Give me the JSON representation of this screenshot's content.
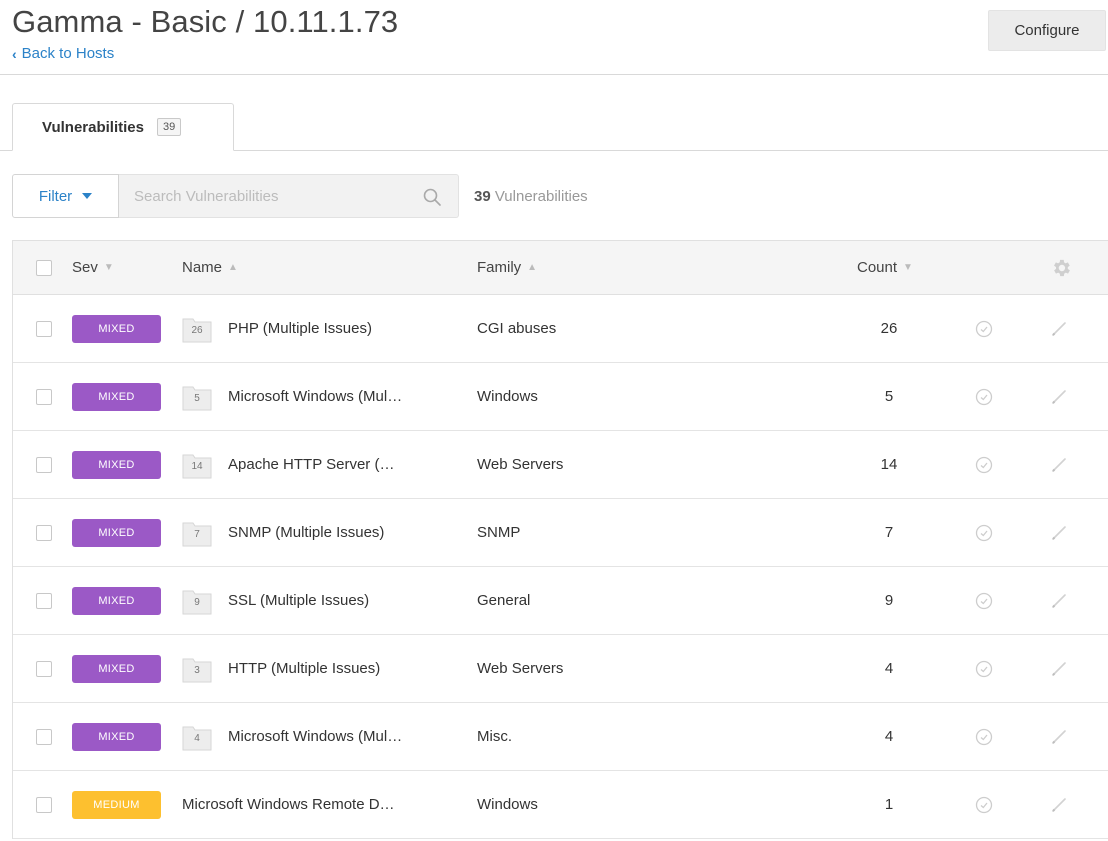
{
  "header": {
    "title": "Gamma - Basic / 10.11.1.73",
    "back_label": "Back to Hosts",
    "configure_label": "Configure"
  },
  "tabs": [
    {
      "label": "Vulnerabilities",
      "count": "39"
    }
  ],
  "toolbar": {
    "filter_label": "Filter",
    "search_placeholder": "Search Vulnerabilities",
    "result_count": "39",
    "result_label": "Vulnerabilities"
  },
  "table": {
    "columns": {
      "sev": "Sev",
      "name": "Name",
      "family": "Family",
      "count": "Count"
    },
    "sort_indicators": {
      "sev": "▼",
      "name": "▲",
      "family": "▲",
      "count": "▼"
    },
    "rows": [
      {
        "severity": "MIXED",
        "group_count": "26",
        "name": "PHP (Multiple Issues)",
        "family": "CGI abuses",
        "count": "26"
      },
      {
        "severity": "MIXED",
        "group_count": "5",
        "name": "Microsoft Windows (Mul…",
        "family": "Windows",
        "count": "5"
      },
      {
        "severity": "MIXED",
        "group_count": "14",
        "name": "Apache HTTP Server (…",
        "family": "Web Servers",
        "count": "14"
      },
      {
        "severity": "MIXED",
        "group_count": "7",
        "name": "SNMP (Multiple Issues)",
        "family": "SNMP",
        "count": "7"
      },
      {
        "severity": "MIXED",
        "group_count": "9",
        "name": "SSL (Multiple Issues)",
        "family": "General",
        "count": "9"
      },
      {
        "severity": "MIXED",
        "group_count": "3",
        "name": "HTTP (Multiple Issues)",
        "family": "Web Servers",
        "count": "4"
      },
      {
        "severity": "MIXED",
        "group_count": "4",
        "name": "Microsoft Windows (Mul…",
        "family": "Misc.",
        "count": "4"
      },
      {
        "severity": "MEDIUM",
        "group_count": "",
        "name": "Microsoft Windows Remote D…",
        "family": "Windows",
        "count": "1"
      }
    ]
  },
  "colors": {
    "link": "#2b82c8",
    "mixed": "#9b59c6",
    "medium": "#fdc02f"
  }
}
